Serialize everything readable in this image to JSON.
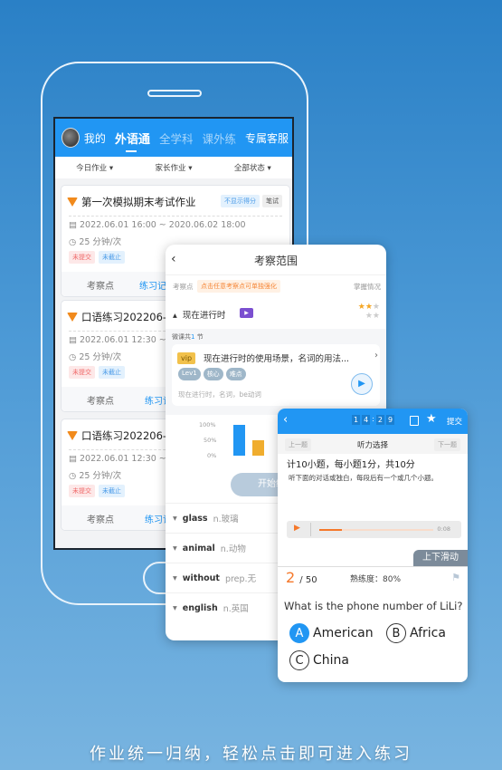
{
  "header": {
    "my": "我的",
    "tabs": [
      "外语通",
      "全学科",
      "课外练"
    ],
    "service": "专属客服"
  },
  "filters": [
    "今日作业 ▾",
    "家长作业 ▾",
    "全部状态 ▾"
  ],
  "cards": [
    {
      "title": "第一次模拟期末考试作业",
      "badges": [
        "不显示得分",
        "笔试"
      ],
      "date": "2022.06.01 16:00 ~ 2020.06.02 18:00",
      "duration": "25 分钟/次",
      "tags": [
        "未提交",
        "未截止"
      ],
      "foot": [
        "考察点",
        "练习记录"
      ]
    },
    {
      "title": "口语练习202206-1",
      "date": "2022.06.01 12:30 ~ 202",
      "duration": "25 分钟/次",
      "tags": [
        "未提交",
        "未截止"
      ],
      "foot": [
        "考察点",
        "练习记"
      ]
    },
    {
      "title": "口语练习202206-2",
      "date": "2022.06.01 12:30 ~ 202",
      "duration": "25 分钟/次",
      "tags": [
        "未提交",
        "未截止"
      ],
      "foot": [
        "考察点",
        "练习记"
      ]
    }
  ],
  "scope": {
    "title": "考察范围",
    "label": "考察点",
    "hint": "点击任意考察点可单独强化",
    "mastery": "掌握情况",
    "topic": "现在进行时",
    "stars": "2/5",
    "lesson_count_prefix": "微课共",
    "lesson_count": "1",
    "lesson_count_suffix": "节",
    "lesson": {
      "vip": "vip",
      "title": "现在进行时的使用场景，名词的用法...",
      "tags": [
        "Lev1",
        "核心",
        "难点"
      ],
      "keywords": "现在进行时，名词，be动词"
    },
    "chart": {
      "ticks": [
        "100%",
        "50%",
        "0%"
      ],
      "values": [
        100,
        50
      ]
    },
    "start": "开始练习",
    "words": [
      {
        "w": "glass",
        "m": "n.玻璃"
      },
      {
        "w": "animal",
        "m": "n.动物"
      },
      {
        "w": "without",
        "m": "prep.无"
      },
      {
        "w": "english",
        "m": "n.英国"
      }
    ]
  },
  "quiz": {
    "timer": [
      "1",
      "4",
      "2",
      "9"
    ],
    "submit": "提交",
    "prev": "上一题",
    "next": "下一题",
    "section": "听力选择",
    "summary": "计10小题，每小题1分，共10分",
    "instruction": "听下面的对话或独白，每段后有一个或几个小题。",
    "audio_time": "0:08",
    "audio_progress": 0.2,
    "scroll_hint": "上下滑动",
    "current": "2",
    "total": "/ 50",
    "proficiency": "熟练度：80%",
    "question": "What is the phone number of LiLi?",
    "options": [
      {
        "k": "A",
        "t": "American",
        "selected": true
      },
      {
        "k": "B",
        "t": "Africa"
      },
      {
        "k": "C",
        "t": "China"
      }
    ]
  },
  "caption": "作业统一归纳，轻松点击即可进入练习",
  "colors": {
    "brand": "#2196f3",
    "orange": "#f18a1c"
  }
}
